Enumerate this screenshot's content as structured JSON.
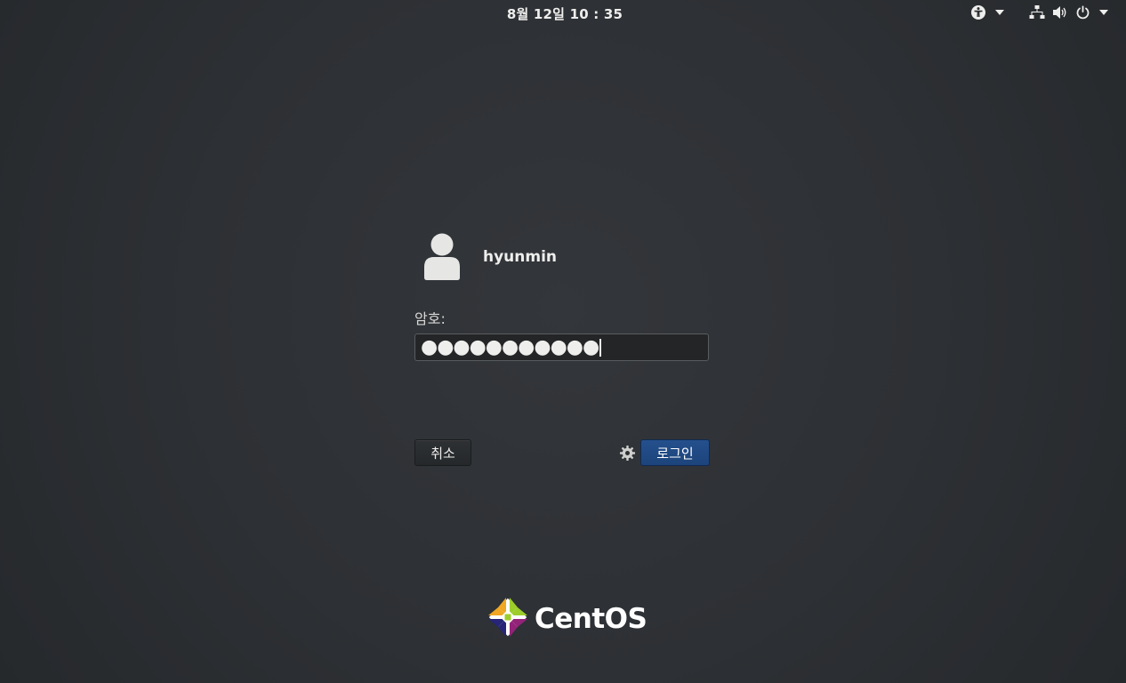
{
  "topbar": {
    "clock": "8월 12일  10 : 35",
    "icons": [
      "accessibility-icon",
      "network-icon",
      "volume-icon",
      "power-icon"
    ]
  },
  "login": {
    "username": "hyunmin",
    "password_label": "암호:",
    "password_value": "●●●●●●●●●●●",
    "cancel_label": "취소",
    "login_label": "로그인"
  },
  "branding": {
    "logo_text": "CentOS"
  },
  "colors": {
    "background": "#2c2f33",
    "login_button": "#1f4a84",
    "text": "#eeeeec"
  }
}
